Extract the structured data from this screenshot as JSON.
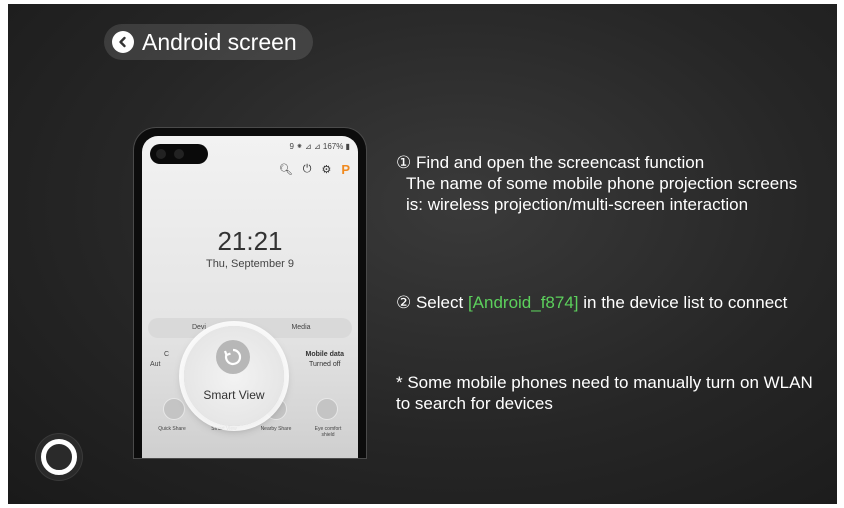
{
  "header": {
    "back_label": "Android screen"
  },
  "phone": {
    "status": "9 ⁕ ⊿ ⊿ 167% ▮",
    "time": "21:21",
    "date": "Thu, September 9",
    "tabs": [
      "Devi",
      "Media"
    ],
    "mobile_data": {
      "title": "Mobile data",
      "state": "Turned off"
    },
    "partial_labels": [
      "C",
      "Aut"
    ],
    "smart_view_label": "Smart View",
    "tiles": [
      "Quick Share",
      "Smart View",
      "Nearby Share",
      "Eye comfort shield"
    ]
  },
  "instructions": {
    "step1_line1": "① Find and open the screencast function",
    "step1_line2": "The name of some mobile phone projection screens is: wireless projection/multi-screen interaction",
    "step2_prefix": "② Select ",
    "step2_device": "[Android_f874]",
    "step2_suffix": " in the device list to connect",
    "note": "* Some mobile phones need to manually turn on WLAN to search for devices"
  },
  "colors": {
    "highlight": "#5cd05c",
    "background": "#262626"
  }
}
